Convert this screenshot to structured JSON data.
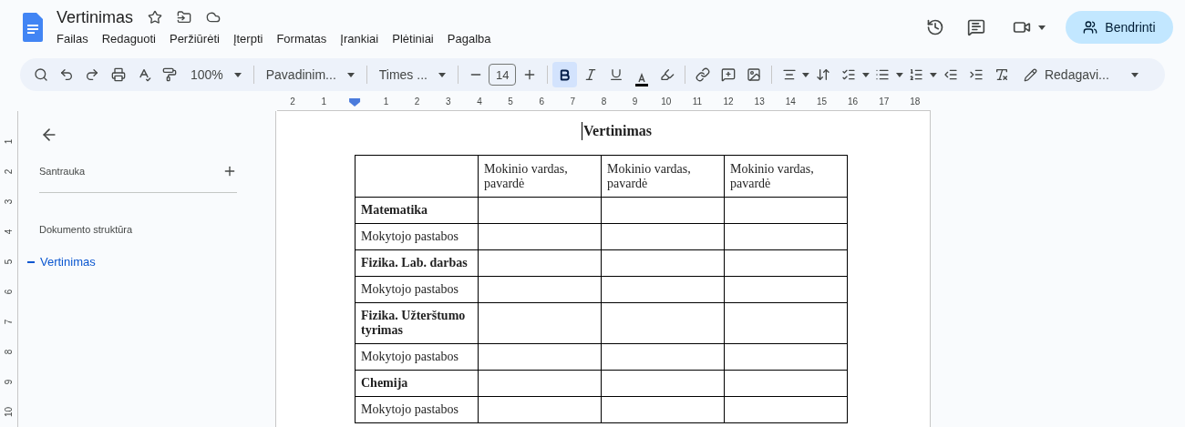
{
  "document": {
    "title": "Vertinimas"
  },
  "menu": [
    "Failas",
    "Redaguoti",
    "Peržiūrėti",
    "Įterpti",
    "Formatas",
    "Įrankiai",
    "Plėtiniai",
    "Pagalba"
  ],
  "share_button": "Bendrinti",
  "toolbar": {
    "zoom": "100%",
    "style": "Pavadinim...",
    "font": "Times ...",
    "font_size": "14",
    "bold_active": true,
    "mode": "Redagavi..."
  },
  "ruler": {
    "left_labels": [
      "2",
      "1"
    ],
    "labels": [
      "1",
      "2",
      "3",
      "4",
      "5",
      "6",
      "7",
      "8",
      "9",
      "10",
      "11",
      "12",
      "13",
      "14",
      "15",
      "16",
      "17",
      "18"
    ],
    "vertical_labels": [
      "1",
      "2",
      "3",
      "4",
      "5",
      "6",
      "7",
      "8",
      "9",
      "10"
    ]
  },
  "sidebar": {
    "summary": "Santrauka",
    "outline_heading": "Dokumento struktūra",
    "outline": [
      {
        "label": "Vertinimas",
        "selected": true
      }
    ]
  },
  "page": {
    "heading": "Vertinimas",
    "table": {
      "columns": [
        "",
        "Mokinio vardas, pavardė",
        "Mokinio vardas, pavardė",
        "Mokinio vardas, pavardė"
      ],
      "rows": [
        {
          "label": "Matematika",
          "bold": true
        },
        {
          "label": "Mokytojo pastabos",
          "bold": false
        },
        {
          "label": "Fizika. Lab. darbas",
          "bold": true
        },
        {
          "label": "Mokytojo pastabos",
          "bold": false
        },
        {
          "label": "Fizika. Užterštumo tyrimas",
          "bold": true
        },
        {
          "label": "Mokytojo pastabos",
          "bold": false
        },
        {
          "label": "Chemija",
          "bold": true
        },
        {
          "label": "Mokytojo pastabos",
          "bold": false
        }
      ]
    }
  }
}
